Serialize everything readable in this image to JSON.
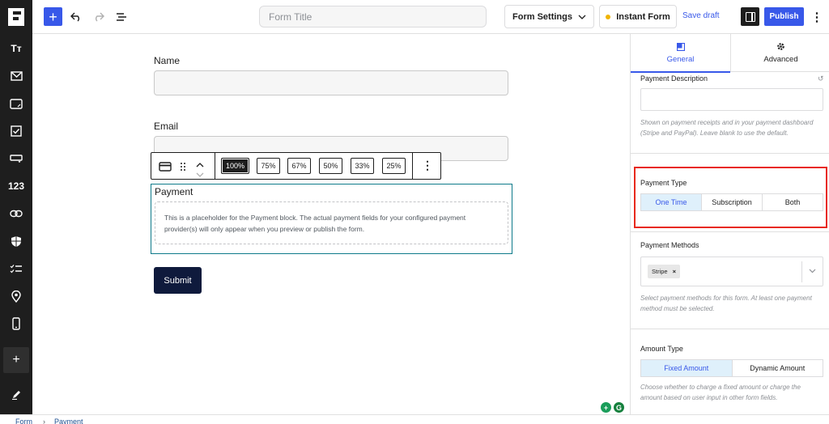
{
  "header": {
    "form_title_placeholder": "Form Title",
    "form_settings_label": "Form Settings",
    "instant_form_label": "Instant Form",
    "save_draft_label": "Save draft",
    "publish_label": "Publish"
  },
  "sidebar": {
    "items": [
      {
        "icon": "text-size-icon",
        "label": "Tт"
      },
      {
        "icon": "mail-icon"
      },
      {
        "icon": "textarea-icon"
      },
      {
        "icon": "checkbox-icon"
      },
      {
        "icon": "select-icon"
      },
      {
        "icon": "number-icon",
        "label": "123"
      },
      {
        "icon": "link-icon"
      },
      {
        "icon": "shield-icon"
      },
      {
        "icon": "checklist-icon"
      },
      {
        "icon": "location-pin-icon"
      },
      {
        "icon": "phone-icon"
      },
      {
        "icon": "plus-icon"
      },
      {
        "icon": "pencil-icon"
      }
    ]
  },
  "canvas": {
    "name_label": "Name",
    "email_label": "Email",
    "width_options": [
      "100%",
      "75%",
      "67%",
      "50%",
      "33%",
      "25%"
    ],
    "active_width": "100%",
    "payment_title": "Payment",
    "payment_placeholder": "This is a placeholder for the Payment block. The actual payment fields for your configured payment provider(s) will only appear when you preview or publish the form.",
    "submit_label": "Submit"
  },
  "panel": {
    "tabs": [
      {
        "label": "General",
        "icon": "general-icon",
        "active": true
      },
      {
        "label": "Advanced",
        "icon": "gear-icon",
        "active": false
      }
    ],
    "payment_description_label": "Payment Description",
    "payment_description_value": "",
    "payment_description_help": "Shown on payment receipts and in your payment dashboard (Stripe and PayPal). Leave blank to use the default.",
    "payment_type_label": "Payment Type",
    "payment_type_options": [
      "One Time",
      "Subscription",
      "Both"
    ],
    "payment_type_selected": "One Time",
    "payment_methods_label": "Payment Methods",
    "payment_methods_selected": [
      "Stripe"
    ],
    "payment_methods_help": "Select payment methods for this form. At least one payment method must be selected.",
    "amount_type_label": "Amount Type",
    "amount_type_options": [
      "Fixed Amount",
      "Dynamic Amount"
    ],
    "amount_type_selected": "Fixed Amount",
    "amount_type_help": "Choose whether to charge a fixed amount or charge the amount based on user input in other form fields."
  },
  "breadcrumb": {
    "items": [
      "Form",
      "Payment"
    ],
    "separator": "›"
  },
  "colors": {
    "accent": "#3858e9",
    "sidebar_bg": "#1e1e1e",
    "submit_bg": "#0f1a3c",
    "highlight": "#e8291b",
    "selected_block_border": "#0e7a8a"
  }
}
